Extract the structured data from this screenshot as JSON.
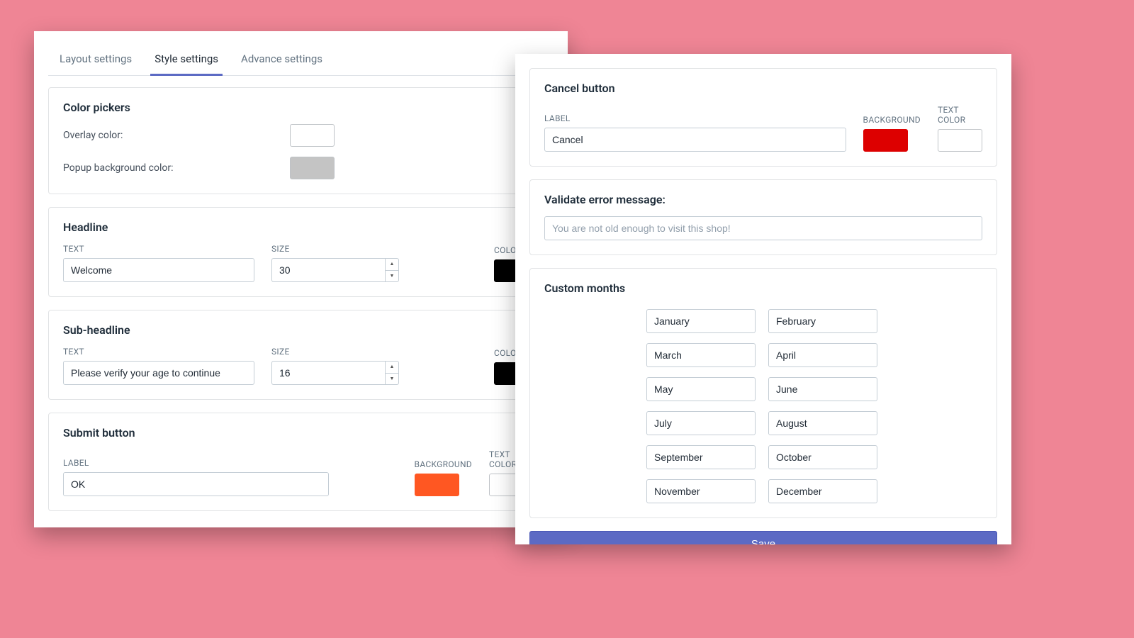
{
  "tabs": {
    "layout": "Layout settings",
    "style": "Style settings",
    "advance": "Advance settings"
  },
  "colorPickers": {
    "title": "Color pickers",
    "overlayLabel": "Overlay color:",
    "overlayColor": "#ffffff",
    "popupBgLabel": "Popup background color:",
    "popupBgColor": "#c4c4c4"
  },
  "fieldLabels": {
    "text": "TEXT",
    "size": "SIZE",
    "color": "COLOR",
    "label": "LABEL",
    "background": "BACKGROUND",
    "textColor": "TEXT COLOR"
  },
  "headline": {
    "title": "Headline",
    "text": "Welcome",
    "size": "30",
    "color": "#000000"
  },
  "subheadline": {
    "title": "Sub-headline",
    "text": "Please verify your age to continue",
    "size": "16",
    "color": "#000000"
  },
  "submit": {
    "title": "Submit button",
    "label": "OK",
    "background": "#ff5722",
    "textColor": "#ffffff"
  },
  "cancel": {
    "title": "Cancel button",
    "label": "Cancel",
    "background": "#dd0000",
    "textColor": "#ffffff"
  },
  "validateError": {
    "title": "Validate error message:",
    "placeholder": "You are not old enough to visit this shop!"
  },
  "customMonths": {
    "title": "Custom months",
    "months": [
      "January",
      "February",
      "March",
      "April",
      "May",
      "June",
      "July",
      "August",
      "September",
      "October",
      "November",
      "December"
    ]
  },
  "saveLabel": "Save"
}
